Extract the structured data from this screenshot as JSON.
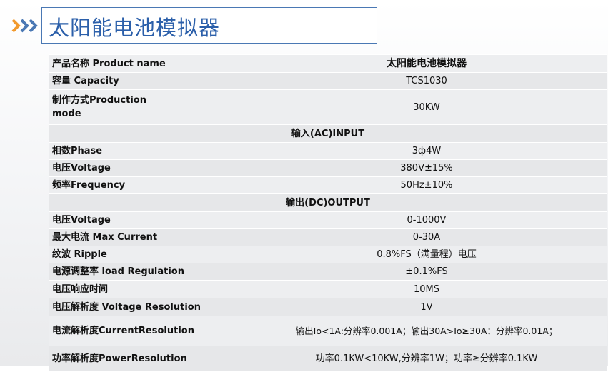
{
  "header": {
    "title": "太阳能电池模拟器"
  },
  "table": {
    "rows": [
      {
        "label": "产品名称 Product name",
        "value": "太阳能电池模拟器"
      },
      {
        "label": "容量 Capacity",
        "value": "TCS1030"
      },
      {
        "label": "制作方式Production mode",
        "value": "30KW"
      },
      {
        "section": "输入(AC)INPUT"
      },
      {
        "label": "相数Phase",
        "value": "3ф4W"
      },
      {
        "label": "电压Voltage",
        "value": "380V±15%"
      },
      {
        "label": "频率Frequency",
        "value": "50Hz±10%"
      },
      {
        "section": "输出(DC)OUTPUT"
      },
      {
        "label": "电压Voltage",
        "value": "0-1000V"
      },
      {
        "label": "最大电流 Max Current",
        "value": "0-30A"
      },
      {
        "label": "纹波 Ripple",
        "value": "0.8%FS（满量程）电压"
      },
      {
        "label": "电源调整率 load Regulation",
        "value": "±0.1%FS"
      },
      {
        "label": "电压响应时间",
        "value": "10MS"
      },
      {
        "label": "电压解析度 Voltage Resolution",
        "value": "1V"
      },
      {
        "label": "电流解析度CurrentResolution",
        "value": "输出Io<1A:分辨率0.001A；输出30A>Io≥30A：分辨率0.01A；"
      },
      {
        "label": "功率解析度PowerResolution",
        "value": "功率0.1KW<10KW,分辨率1W；功率≥分辨率0.1KW"
      }
    ]
  }
}
